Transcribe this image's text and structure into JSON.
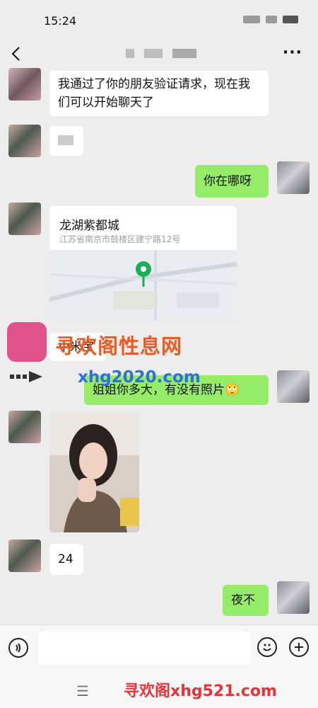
{
  "status": {
    "time": "15:24"
  },
  "nav": {
    "back_icon": "chevron-left-icon",
    "more_label": "···"
  },
  "messages": {
    "m1": "我通过了你的朋友验证请求，现在我们可以开始聊天了",
    "m3": "你在哪呀",
    "location": {
      "name": "龙湖紫都城",
      "address": "江苏省南京市鼓楼区建宁路12号"
    },
    "m5": "小米宝",
    "m6": "姐姐你多大，有没有照片🙄",
    "m8": "24",
    "m9": "夜不"
  },
  "watermark": {
    "name": "寻欢阁性息网",
    "url": "xhg2020.com",
    "bottom": "寻欢阁xhg521.com"
  },
  "input": {
    "placeholder": ""
  },
  "colors": {
    "my_bubble": "#95ec69",
    "their_bubble": "#ffffff",
    "background": "#ededed"
  }
}
